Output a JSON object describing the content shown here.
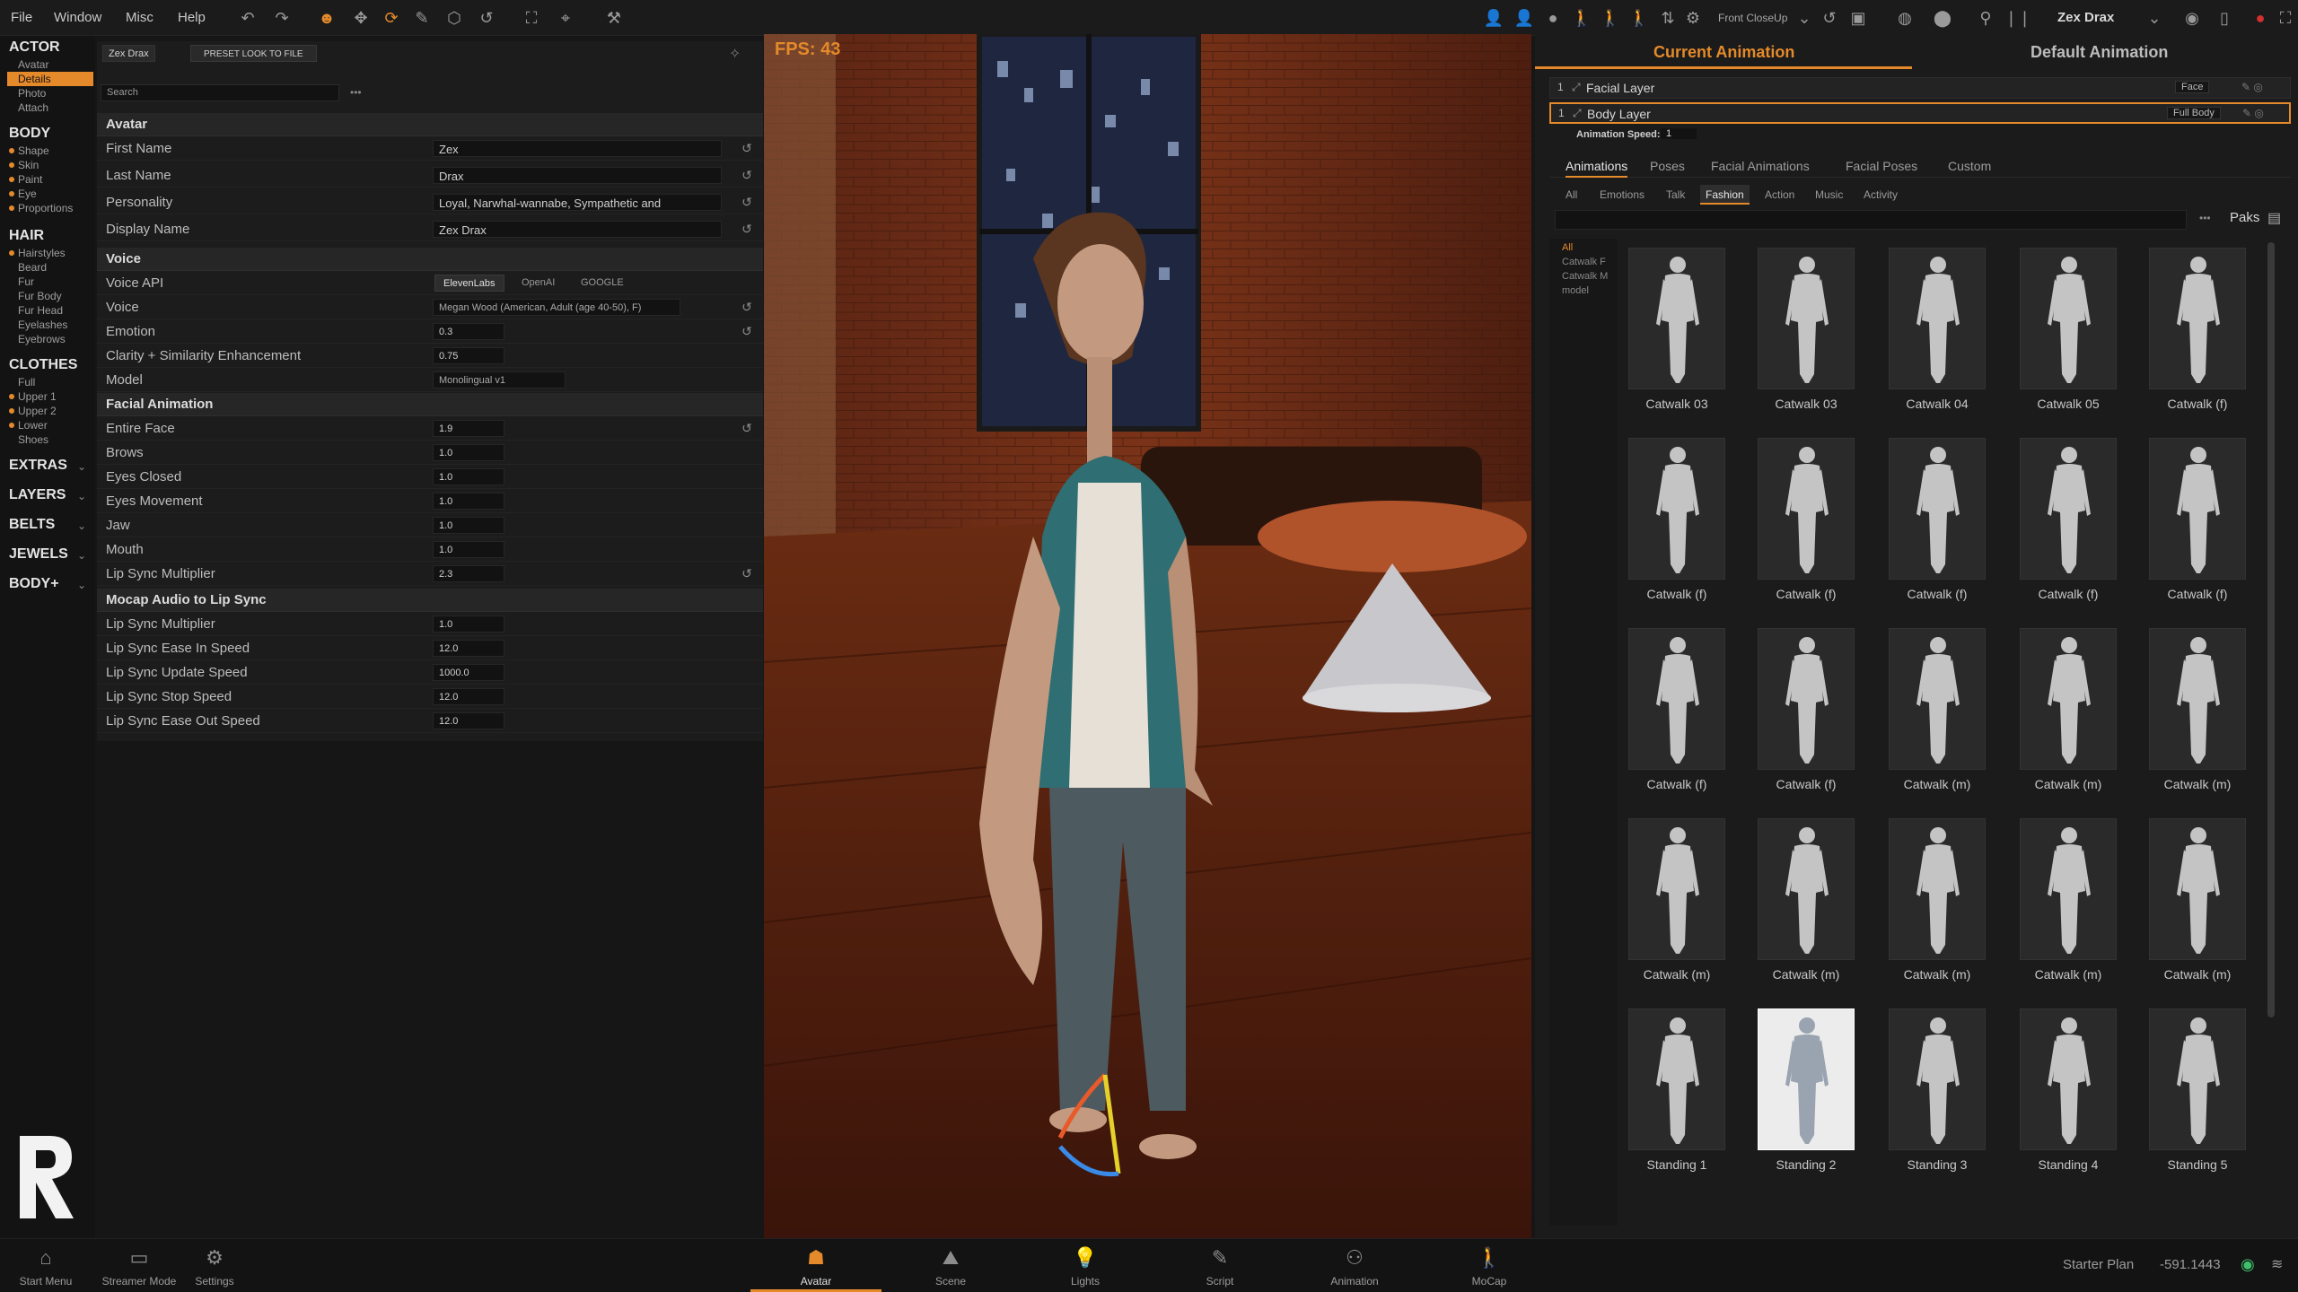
{
  "menu": {
    "file": "File",
    "window": "Window",
    "misc": "Misc",
    "help": "Help"
  },
  "toolbar": {
    "camera_preset": "Front CloseUp",
    "actor_select": "Zex Drax"
  },
  "sidebar": {
    "actor": {
      "heading": "ACTOR",
      "items": [
        "Avatar",
        "Details",
        "Photo",
        "Attach"
      ]
    },
    "body": {
      "heading": "BODY",
      "items": [
        "Shape",
        "Skin",
        "Paint",
        "Eye",
        "Proportions"
      ]
    },
    "hair": {
      "heading": "HAIR",
      "items": [
        "Hairstyles",
        "Beard",
        "Fur",
        "Fur Body",
        "Fur Head",
        "Eyelashes",
        "Eyebrows"
      ]
    },
    "clothes": {
      "heading": "CLOTHES",
      "items": [
        "Full",
        "Upper 1",
        "Upper 2",
        "Lower",
        "Shoes"
      ]
    },
    "extras": "EXTRAS",
    "layers": "LAYERS",
    "belts": "BELTS",
    "jewels": "JEWELS",
    "bodyplus": "BODY+"
  },
  "details": {
    "actor_dropdown": "Zex Drax",
    "preset_button": "PRESET LOOK TO FILE",
    "search_placeholder": "Search",
    "avatar_section": "Avatar",
    "first_name_label": "First Name",
    "first_name": "Zex",
    "last_name_label": "Last Name",
    "last_name": "Drax",
    "personality_label": "Personality",
    "personality": "Loyal, Narwhal-wannabe, Sympathetic and",
    "display_name_label": "Display Name",
    "display_name": "Zex Drax",
    "voice_section": "Voice",
    "voice_api_label": "Voice API",
    "voice_api_options": [
      "ElevenLabs",
      "OpenAI",
      "GOOGLE"
    ],
    "voice_label": "Voice",
    "voice": "Megan Wood (American, Adult (age 40-50), F)",
    "emotion_label": "Emotion",
    "emotion": "0.3",
    "clarity_label": "Clarity + Similarity Enhancement",
    "clarity": "0.75",
    "model_label": "Model",
    "model": "Monolingual v1",
    "facial_section": "Facial Animation",
    "facial_rows": [
      {
        "label": "Entire Face",
        "value": "1.9"
      },
      {
        "label": "Brows",
        "value": "1.0"
      },
      {
        "label": "Eyes Closed",
        "value": "1.0"
      },
      {
        "label": "Eyes Movement",
        "value": "1.0"
      },
      {
        "label": "Jaw",
        "value": "1.0"
      },
      {
        "label": "Mouth",
        "value": "1.0"
      },
      {
        "label": "Lip Sync Multiplier",
        "value": "2.3"
      }
    ],
    "mocap_section": "Mocap Audio to Lip Sync",
    "mocap_rows": [
      {
        "label": "Lip Sync Multiplier",
        "value": "1.0"
      },
      {
        "label": "Lip Sync Ease In Speed",
        "value": "12.0"
      },
      {
        "label": "Lip Sync Update Speed",
        "value": "1000.0"
      },
      {
        "label": "Lip Sync Stop Speed",
        "value": "12.0"
      },
      {
        "label": "Lip Sync Ease Out Speed",
        "value": "12.0"
      }
    ]
  },
  "viewport": {
    "fps": "FPS: 43"
  },
  "right": {
    "tab_current": "Current Animation",
    "tab_default": "Default Animation",
    "facial_layer": {
      "index": "1",
      "name": "Facial Layer",
      "mode": "Face"
    },
    "body_layer": {
      "index": "1",
      "name": "Body Layer",
      "mode": "Full Body"
    },
    "anim_speed_label": "Animation Speed:",
    "anim_speed": "1",
    "subtabs": [
      "Animations",
      "Poses",
      "Facial Animations",
      "Facial Poses",
      "Custom"
    ],
    "filters": [
      "All",
      "Emotions",
      "Talk",
      "Fashion",
      "Action",
      "Music",
      "Activity"
    ],
    "paks_label": "Paks",
    "categories": [
      "All",
      "Catwalk F",
      "Catwalk M",
      "model"
    ],
    "cards": [
      "Catwalk 03",
      "Catwalk 03",
      "Catwalk 04",
      "Catwalk 05",
      "Catwalk (f)",
      "Catwalk (f)",
      "Catwalk (f)",
      "Catwalk (f)",
      "Catwalk (f)",
      "Catwalk (f)",
      "Catwalk (f)",
      "Catwalk (f)",
      "Catwalk (m)",
      "Catwalk (m)",
      "Catwalk (m)",
      "Catwalk (m)",
      "Catwalk (m)",
      "Catwalk (m)",
      "Catwalk (m)",
      "Catwalk (m)",
      "Standing 1",
      "Standing 2",
      "Standing 3",
      "Standing 4",
      "Standing 5"
    ]
  },
  "bottombar": {
    "start_menu": "Start Menu",
    "streamer_mode": "Streamer Mode",
    "settings": "Settings",
    "tabs": [
      "Avatar",
      "Scene",
      "Lights",
      "Script",
      "Animation",
      "MoCap"
    ],
    "plan": "Starter Plan",
    "credits": "-591.1443"
  },
  "colors": {
    "accent": "#e58a2a",
    "panel": "#1c1c1c",
    "background": "#161616"
  }
}
